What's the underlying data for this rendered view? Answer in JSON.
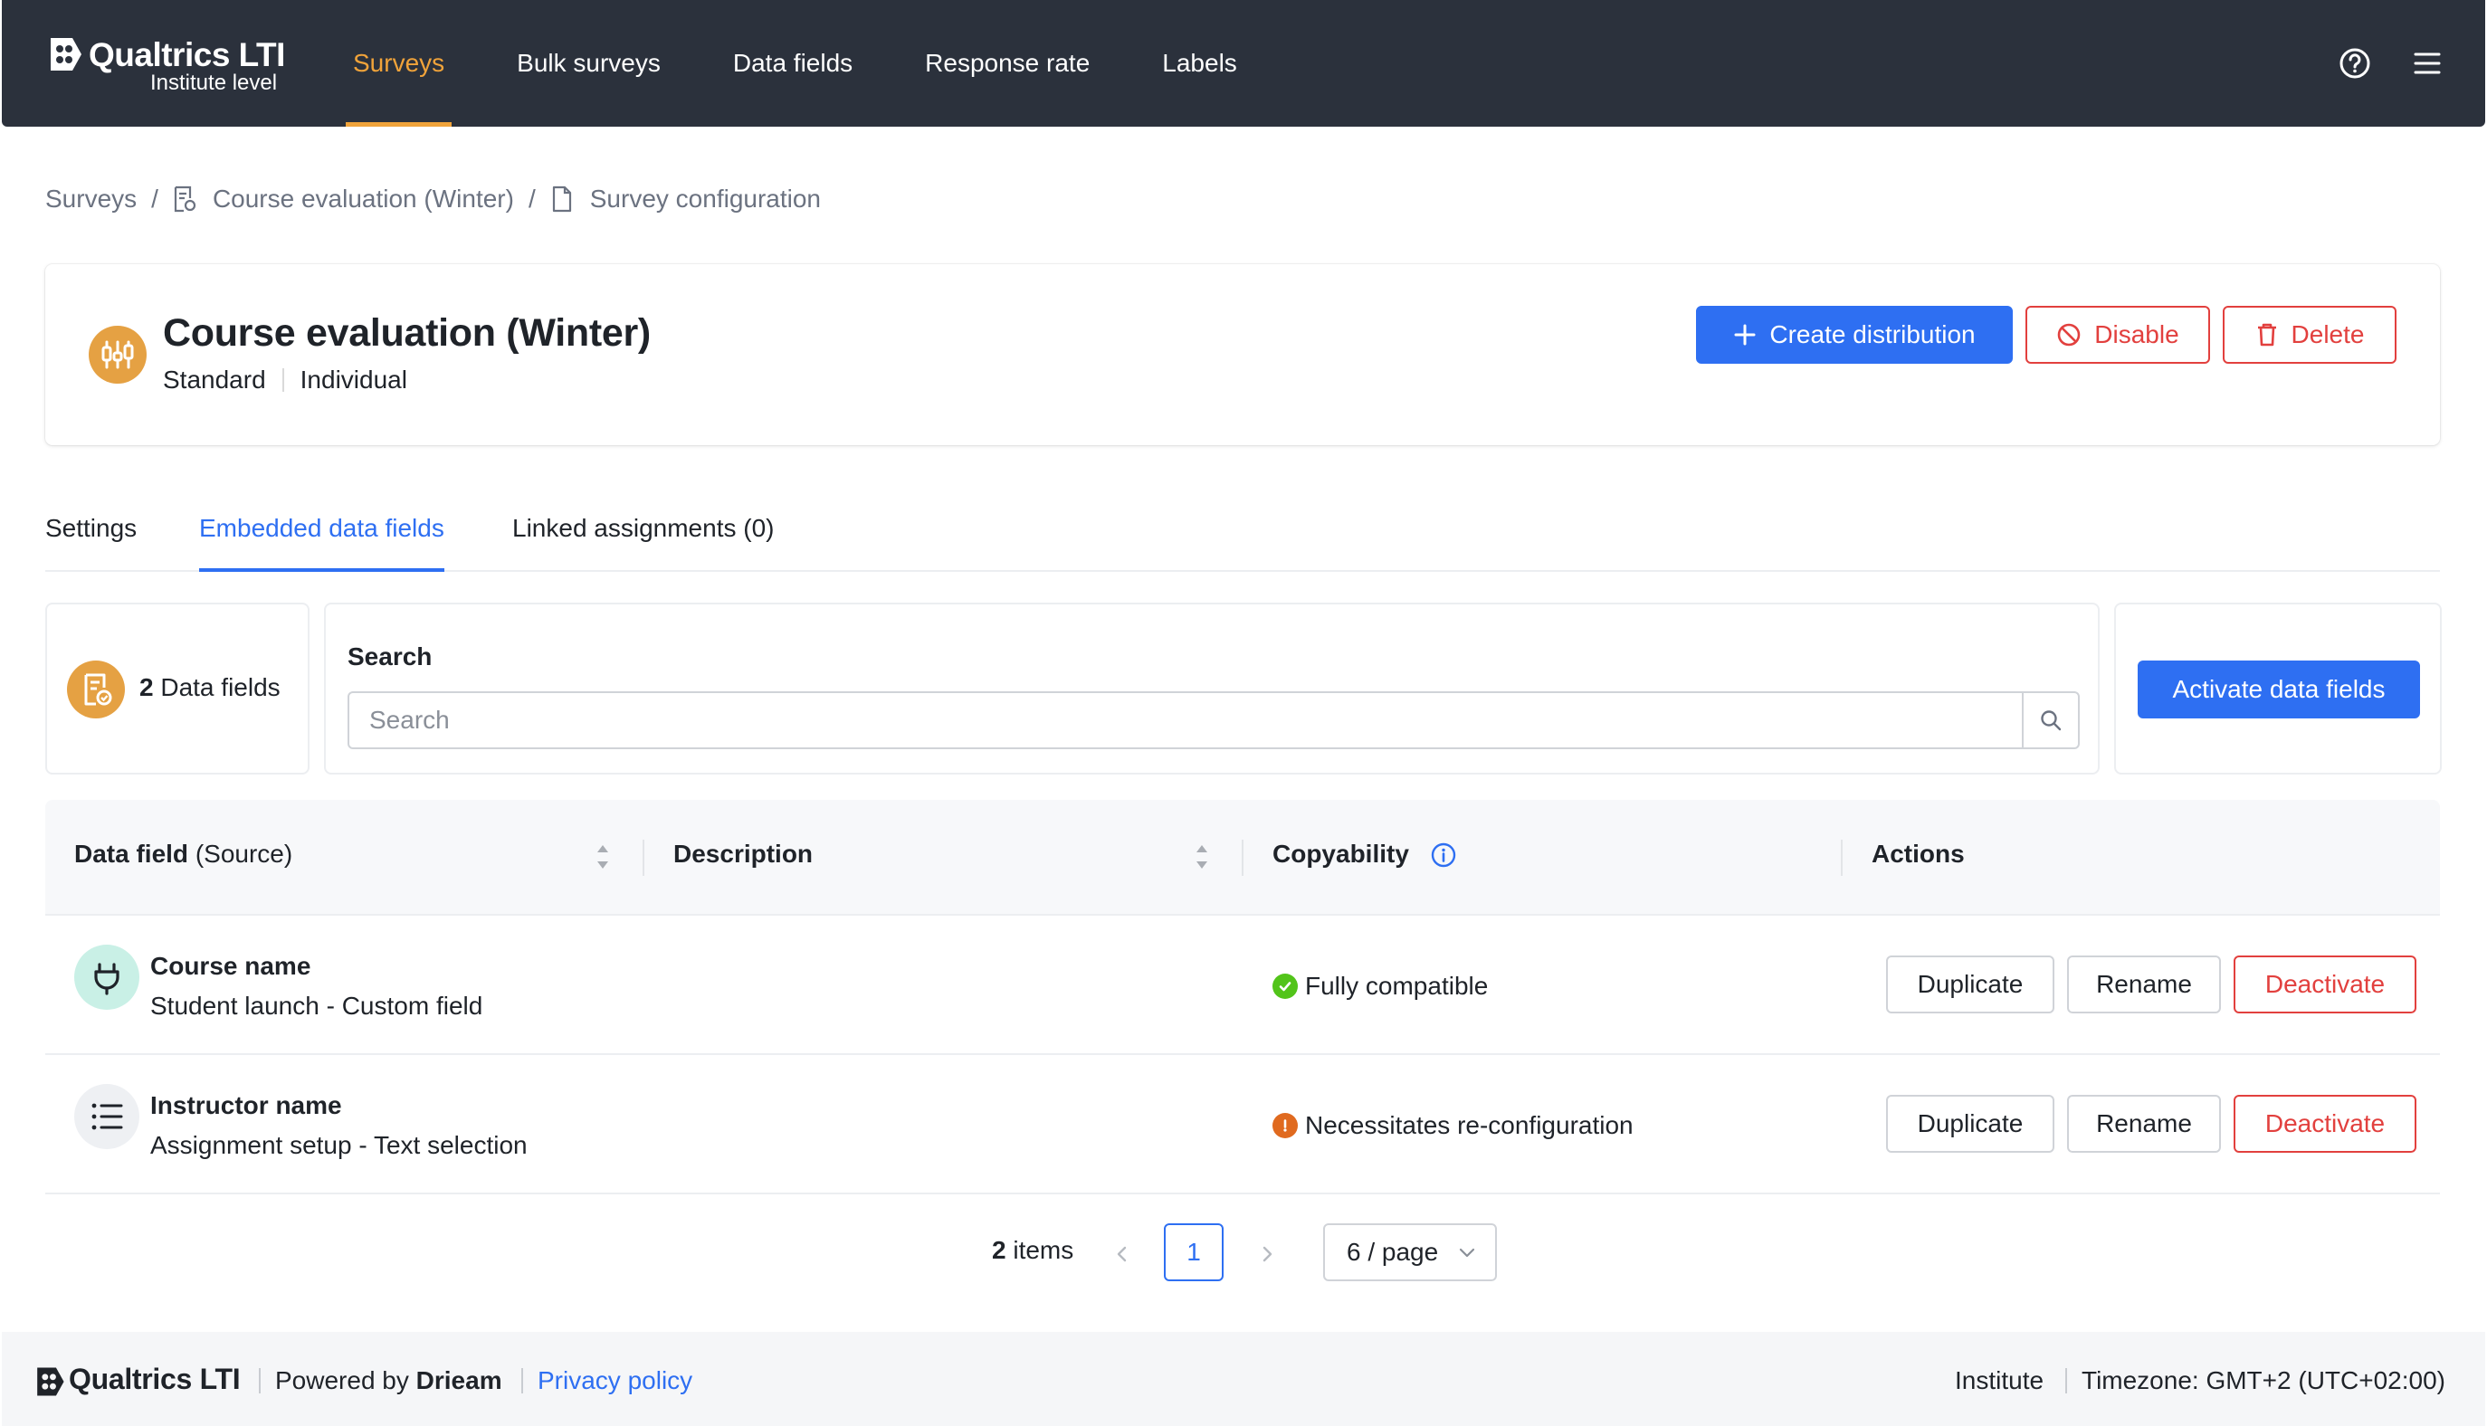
{
  "nav": {
    "brand_name": "Qualtrics LTI",
    "brand_sub": "Institute level",
    "items": [
      {
        "label": "Surveys",
        "active": true
      },
      {
        "label": "Bulk surveys",
        "active": false
      },
      {
        "label": "Data fields",
        "active": false
      },
      {
        "label": "Response rate",
        "active": false
      },
      {
        "label": "Labels",
        "active": false
      }
    ],
    "icons": [
      "help-icon",
      "menu-icon"
    ]
  },
  "breadcrumb": {
    "items": [
      {
        "label": "Surveys",
        "icon": null
      },
      {
        "label": "Course evaluation (Winter)",
        "icon": "survey-doc-icon"
      },
      {
        "label": "Survey configuration",
        "icon": "file-icon"
      }
    ],
    "separator": "/"
  },
  "header": {
    "title": "Course evaluation (Winter)",
    "type": "Standard",
    "mode": "Individual",
    "icon": "sliders-icon",
    "actions": {
      "create_distribution": "Create distribution",
      "disable": "Disable",
      "delete": "Delete"
    }
  },
  "tabs": [
    {
      "label": "Settings",
      "active": false
    },
    {
      "label": "Embedded data fields",
      "active": true
    },
    {
      "label": "Linked assignments (0)",
      "active": false
    }
  ],
  "toolbar": {
    "count_number": "2",
    "count_label": "Data fields",
    "search_label": "Search",
    "search_placeholder": "Search",
    "search_value": "",
    "activate_button": "Activate data fields"
  },
  "table": {
    "columns": {
      "data_field": "Data field",
      "data_field_suffix": "(Source)",
      "description": "Description",
      "copyability": "Copyability",
      "actions": "Actions"
    },
    "rows": [
      {
        "title": "Course name",
        "source": "Student launch - Custom field",
        "description": "",
        "icon": "plug-icon",
        "copyability": "Fully compatible",
        "status": "success",
        "actions": {
          "duplicate": "Duplicate",
          "rename": "Rename",
          "deactivate": "Deactivate"
        }
      },
      {
        "title": "Instructor name",
        "source": "Assignment setup - Text selection",
        "description": "",
        "icon": "list-icon",
        "copyability": "Necessitates re-configuration",
        "status": "warning",
        "actions": {
          "duplicate": "Duplicate",
          "rename": "Rename",
          "deactivate": "Deactivate"
        }
      }
    ]
  },
  "pagination": {
    "total_number": "2",
    "total_label": "items",
    "current_page": "1",
    "page_size": "6 / page"
  },
  "footer": {
    "brand": "Qualtrics LTI",
    "powered_prefix": "Powered by",
    "powered_by": "Drieam",
    "privacy": "Privacy policy",
    "scope": "Institute",
    "timezone": "Timezone: GMT+2 (UTC+02:00)"
  },
  "colors": {
    "nav_bg": "#2b313c",
    "accent_orange": "#f0a33a",
    "primary_blue": "#2e6ff2",
    "danger_red": "#e2403e",
    "success_green": "#52c41a",
    "warning_orange": "#e06a1f"
  }
}
